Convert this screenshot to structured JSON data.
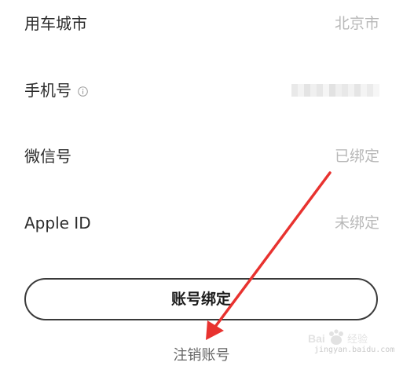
{
  "rows": [
    {
      "label": "用车城市",
      "value": "北京市"
    },
    {
      "label": "手机号",
      "value": "",
      "value_blurred": true
    },
    {
      "label": "微信号",
      "value": "已绑定"
    },
    {
      "label": "Apple ID",
      "value": "未绑定"
    }
  ],
  "info_icon": "info-circle-icon",
  "bind_button": {
    "label": "账号绑定"
  },
  "cancel_account": {
    "label": "注销账号"
  },
  "annotation": {
    "color": "#e8322f",
    "icon": "red-arrow-icon"
  },
  "watermark": {
    "text": "Bai百度 经验",
    "sub": "jingyan.baidu.com"
  },
  "colors": {
    "label": "#2b2b2b",
    "value": "#b8b8b8",
    "button_border": "#3a3a3a",
    "link": "#666666"
  }
}
